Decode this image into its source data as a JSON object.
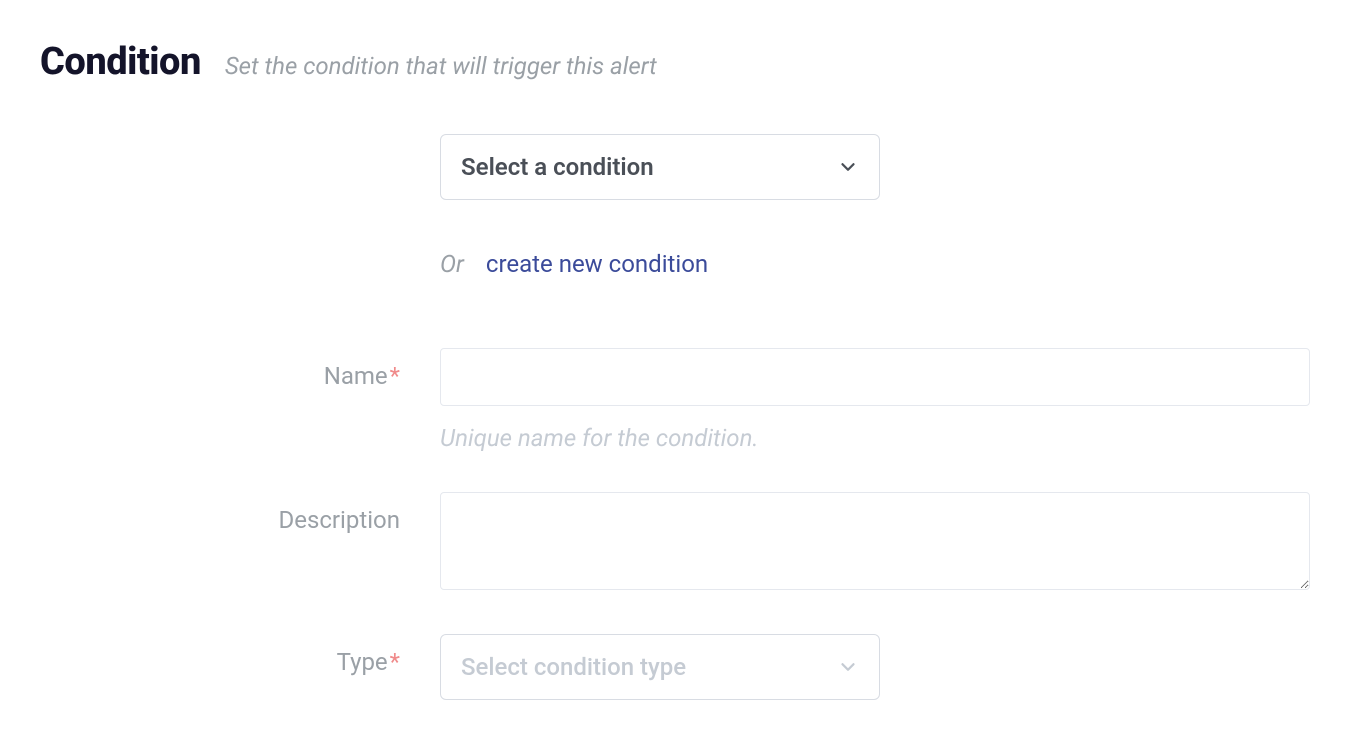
{
  "header": {
    "title": "Condition",
    "subtitle": "Set the condition that will trigger this alert"
  },
  "selectCondition": {
    "placeholder": "Select a condition",
    "orLabel": "Or",
    "createLink": "create new condition"
  },
  "fields": {
    "name": {
      "label": "Name",
      "required": "*",
      "value": "",
      "help": "Unique name for the condition."
    },
    "description": {
      "label": "Description",
      "value": ""
    },
    "type": {
      "label": "Type",
      "required": "*",
      "placeholder": "Select condition type"
    }
  }
}
